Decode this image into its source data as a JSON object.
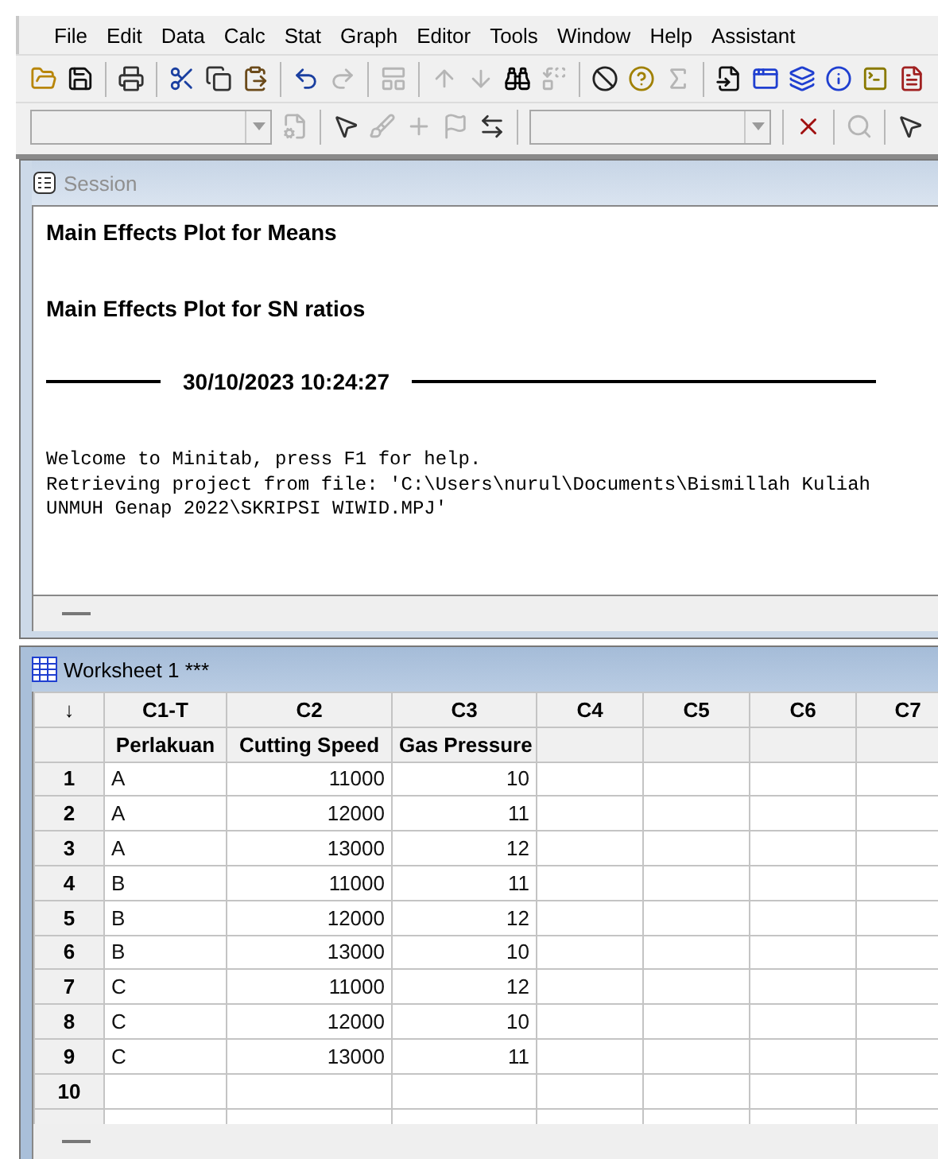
{
  "menu": [
    {
      "label": "File"
    },
    {
      "label": "Edit"
    },
    {
      "label": "Data"
    },
    {
      "label": "Calc"
    },
    {
      "label": "Stat"
    },
    {
      "label": "Graph"
    },
    {
      "label": "Editor"
    },
    {
      "label": "Tools"
    },
    {
      "label": "Window"
    },
    {
      "label": "Help"
    },
    {
      "label": "Assistant"
    }
  ],
  "toolbar_1": [
    {
      "kind": "open",
      "disabled": false
    },
    {
      "kind": "save",
      "disabled": false
    },
    {
      "kind": "separator"
    },
    {
      "kind": "print",
      "disabled": false
    },
    {
      "kind": "separator"
    },
    {
      "kind": "cut",
      "disabled": false
    },
    {
      "kind": "copy",
      "disabled": false
    },
    {
      "kind": "paste",
      "disabled": false
    },
    {
      "kind": "separator"
    },
    {
      "kind": "undo",
      "disabled": false
    },
    {
      "kind": "redo",
      "disabled": true
    },
    {
      "kind": "separator"
    },
    {
      "kind": "layout",
      "disabled": true
    },
    {
      "kind": "separator"
    },
    {
      "kind": "up",
      "disabled": true
    },
    {
      "kind": "down",
      "disabled": true
    },
    {
      "kind": "find",
      "disabled": false
    },
    {
      "kind": "replace",
      "disabled": true
    },
    {
      "kind": "separator"
    },
    {
      "kind": "cancel",
      "disabled": false
    },
    {
      "kind": "help",
      "disabled": false
    },
    {
      "kind": "stats",
      "disabled": true
    },
    {
      "kind": "separator"
    },
    {
      "kind": "append",
      "disabled": false
    },
    {
      "kind": "windows",
      "disabled": false
    },
    {
      "kind": "graphs",
      "disabled": false
    },
    {
      "kind": "info",
      "disabled": false
    },
    {
      "kind": "command",
      "disabled": false
    },
    {
      "kind": "report",
      "disabled": false
    }
  ],
  "toolbar_2": [
    {
      "kind": "dropdown",
      "disabled": true
    },
    {
      "kind": "properties",
      "disabled": true
    },
    {
      "kind": "separator"
    },
    {
      "kind": "pointer",
      "disabled": false
    },
    {
      "kind": "brush",
      "disabled": true
    },
    {
      "kind": "crosshair",
      "disabled": true
    },
    {
      "kind": "flag",
      "disabled": true
    },
    {
      "kind": "swap",
      "disabled": false
    },
    {
      "kind": "separator"
    },
    {
      "kind": "dropdown",
      "disabled": true
    },
    {
      "kind": "separator"
    },
    {
      "kind": "delete",
      "disabled": false
    },
    {
      "kind": "separator"
    },
    {
      "kind": "zoom",
      "disabled": true
    },
    {
      "kind": "separator"
    },
    {
      "kind": "pointer",
      "disabled": false
    }
  ],
  "session": {
    "title": "Session",
    "active": false,
    "headings": [
      "Main Effects Plot for Means",
      "Main Effects Plot for SN ratios"
    ],
    "timestamp": "30/10/2023 10:24:27",
    "messages": [
      "Welcome to Minitab, press F1 for help.",
      "Retrieving project from file: 'C:\\Users\\nurul\\Documents\\Bismillah Kuliah UNMUH Genap 2022\\SKRIPSI WIWID.MPJ'"
    ]
  },
  "worksheet": {
    "title": "Worksheet 1 ***",
    "active": true,
    "corner": "↓",
    "columns": [
      {
        "id": "C1-T",
        "name": "Perlakuan",
        "kind": "text"
      },
      {
        "id": "C2",
        "name": "Cutting Speed",
        "kind": "numeric"
      },
      {
        "id": "C3",
        "name": "Gas Pressure",
        "kind": "numeric"
      },
      {
        "id": "C4"
      },
      {
        "id": "C5"
      },
      {
        "id": "C6"
      },
      {
        "id": "C7"
      }
    ],
    "rows": [
      {
        "number": "1",
        "cells": [
          "A",
          "11000",
          "10"
        ]
      },
      {
        "number": "2",
        "cells": [
          "A",
          "12000",
          "11"
        ]
      },
      {
        "number": "3",
        "cells": [
          "A",
          "13000",
          "12"
        ]
      },
      {
        "number": "4",
        "cells": [
          "B",
          "11000",
          "11"
        ]
      },
      {
        "number": "5",
        "cells": [
          "B",
          "12000",
          "12"
        ]
      },
      {
        "number": "6",
        "cells": [
          "B",
          "13000",
          "10"
        ]
      },
      {
        "number": "7",
        "cells": [
          "C",
          "11000",
          "12"
        ]
      },
      {
        "number": "8",
        "cells": [
          "C",
          "12000",
          "10"
        ]
      },
      {
        "number": "9",
        "cells": [
          "C",
          "13000",
          "11"
        ]
      },
      {
        "number": "10",
        "cells": []
      }
    ]
  }
}
